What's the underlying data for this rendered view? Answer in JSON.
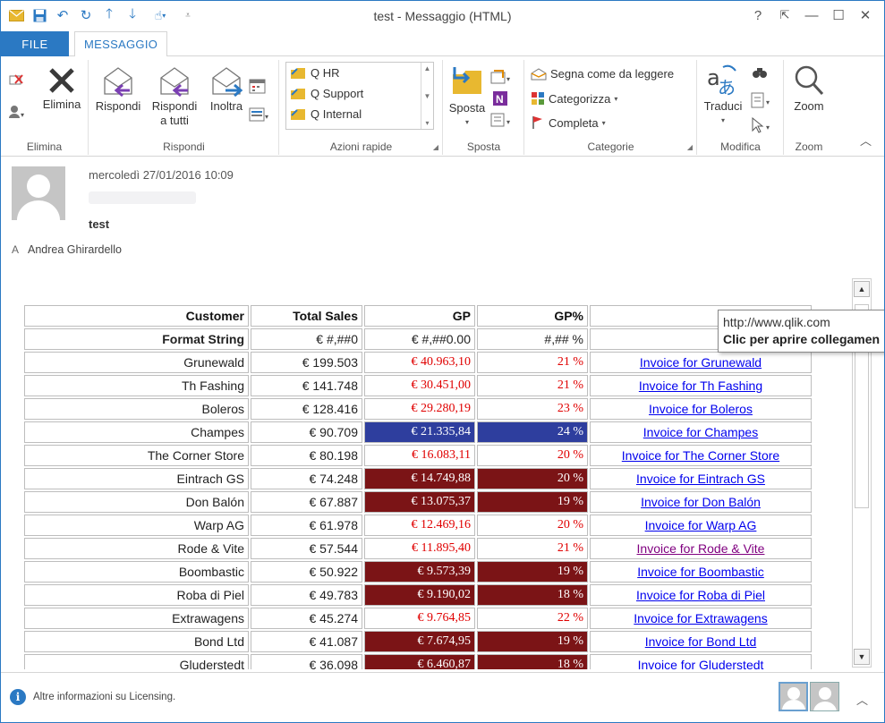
{
  "window": {
    "title": "test - Messaggio (HTML)",
    "controls": [
      "?",
      "⇱",
      "—",
      "☐",
      "✕"
    ]
  },
  "tabs": {
    "file": "FILE",
    "message": "MESSAGGIO"
  },
  "ribbon": {
    "elimina": {
      "button": "Elimina",
      "group": "Elimina"
    },
    "rispondi": {
      "reply": "Rispondi",
      "reply_all_line1": "Rispondi",
      "reply_all_line2": "a tutti",
      "forward": "Inoltra",
      "group": "Rispondi"
    },
    "azioni_rapide": {
      "items": [
        "Q HR",
        "Q Support",
        "Q Internal"
      ],
      "group": "Azioni rapide"
    },
    "sposta": {
      "button": "Sposta",
      "group": "Sposta"
    },
    "categorie": {
      "mark_read": "Segna come da leggere",
      "categorize": "Categorizza",
      "follow_up": "Completa",
      "group": "Categorie"
    },
    "modifica": {
      "translate": "Traduci",
      "group": "Modifica"
    },
    "zoom": {
      "button": "Zoom",
      "group": "Zoom"
    }
  },
  "message": {
    "date": "mercoledì 27/01/2016 10:09",
    "subject": "test",
    "to_prefix": "A",
    "recipient": "Andrea Ghirardello"
  },
  "table": {
    "header": {
      "customer": "Customer",
      "sales": "Total Sales",
      "gp": "GP",
      "gp_pct": "GP%"
    },
    "format": {
      "customer": "Format String",
      "sales": "€ #,##0",
      "gp": "€ #,##0.00",
      "gp_pct": "#,## %"
    },
    "rows": [
      {
        "customer": "Grunewald",
        "sales": "€ 199.503",
        "gp": "€ 40.963,10",
        "gp_pct": "21 %",
        "link": "Invoice for Grunewald"
      },
      {
        "customer": "Th Fashing",
        "sales": "€ 141.748",
        "gp": "€ 30.451,00",
        "gp_pct": "21 %",
        "link": "Invoice for Th Fashing"
      },
      {
        "customer": "Boleros",
        "sales": "€ 128.416",
        "gp": "€ 29.280,19",
        "gp_pct": "23 %",
        "link": "Invoice for Boleros"
      },
      {
        "customer": "Champes",
        "sales": "€ 90.709",
        "gp": "€ 21.335,84",
        "gp_pct": "24 %",
        "link": "Invoice for Champes"
      },
      {
        "customer": "The Corner Store",
        "sales": "€ 80.198",
        "gp": "€ 16.083,11",
        "gp_pct": "20 %",
        "link": "Invoice for The Corner Store"
      },
      {
        "customer": "Eintrach GS",
        "sales": "€ 74.248",
        "gp": "€ 14.749,88",
        "gp_pct": "20 %",
        "link": "Invoice for Eintrach GS"
      },
      {
        "customer": "Don Balón",
        "sales": "€ 67.887",
        "gp": "€ 13.075,37",
        "gp_pct": "19 %",
        "link": "Invoice for Don Balón"
      },
      {
        "customer": "Warp AG",
        "sales": "€ 61.978",
        "gp": "€ 12.469,16",
        "gp_pct": "20 %",
        "link": "Invoice for Warp AG"
      },
      {
        "customer": "Rode & Vite",
        "sales": "€ 57.544",
        "gp": "€ 11.895,40",
        "gp_pct": "21 %",
        "link": "Invoice for Rode & Vite"
      },
      {
        "customer": "Boombastic",
        "sales": "€ 50.922",
        "gp": "€ 9.573,39",
        "gp_pct": "19 %",
        "link": "Invoice for Boombastic"
      },
      {
        "customer": "Roba di Piel",
        "sales": "€ 49.783",
        "gp": "€ 9.190,02",
        "gp_pct": "18 %",
        "link": "Invoice for Roba di Piel"
      },
      {
        "customer": "Extrawagens",
        "sales": "€ 45.274",
        "gp": "€ 9.764,85",
        "gp_pct": "22 %",
        "link": "Invoice for Extrawagens"
      },
      {
        "customer": "Bond Ltd",
        "sales": "€ 41.087",
        "gp": "€ 7.674,95",
        "gp_pct": "19 %",
        "link": "Invoice for Bond Ltd"
      },
      {
        "customer": "Gluderstedt",
        "sales": "€ 36.098",
        "gp": "€ 6.460,87",
        "gp_pct": "18 %",
        "link": "Invoice for Gluderstedt"
      }
    ]
  },
  "tooltip": {
    "url": "http://www.qlik.com",
    "hint": "Clic per aprire collegamen"
  },
  "footer": {
    "info": "Altre informazioni su Licensing."
  },
  "colors": {
    "accent": "#2b79c3",
    "highlight_blue": "#2e3e9e",
    "highlight_red": "#7b1416",
    "value_red": "#e00000",
    "link": "#0000ee",
    "visited_link": "#800080"
  }
}
